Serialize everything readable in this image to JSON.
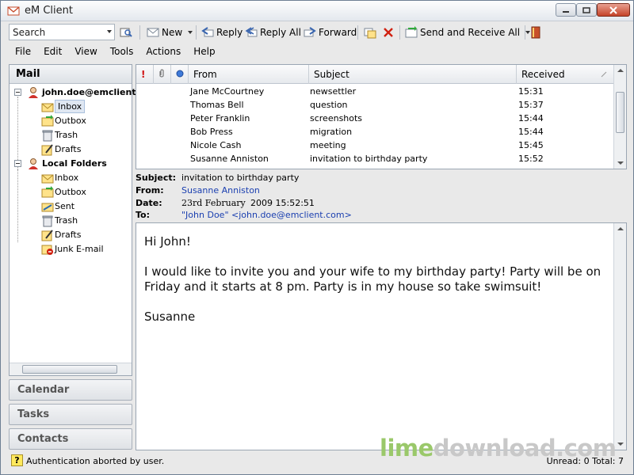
{
  "window": {
    "title": "eM Client"
  },
  "toolbar": {
    "search_placeholder": "Search",
    "new_label": "New",
    "reply_label": "Reply",
    "reply_all_label": "Reply All",
    "forward_label": "Forward",
    "send_receive_label": "Send and Receive All"
  },
  "menu": [
    "File",
    "Edit",
    "View",
    "Tools",
    "Actions",
    "Help"
  ],
  "sidebar": {
    "header": "Mail",
    "account": "john.doe@emclient.",
    "account_folders": [
      "Inbox",
      "Outbox",
      "Trash",
      "Drafts"
    ],
    "local": "Local Folders",
    "local_folders": [
      "Inbox",
      "Outbox",
      "Sent",
      "Trash",
      "Drafts",
      "Junk E-mail"
    ],
    "nav": [
      "Calendar",
      "Tasks",
      "Contacts"
    ]
  },
  "list": {
    "columns": {
      "from": "From",
      "subject": "Subject",
      "received": "Received"
    },
    "rows": [
      {
        "from": "Jane McCourtney",
        "subject": "newsettler",
        "received": "15:31"
      },
      {
        "from": "Thomas Bell",
        "subject": "question",
        "received": "15:37"
      },
      {
        "from": "Peter Franklin",
        "subject": "screenshots",
        "received": "15:44"
      },
      {
        "from": "Bob Press",
        "subject": "migration",
        "received": "15:44"
      },
      {
        "from": "Nicole Cash",
        "subject": "meeting",
        "received": "15:45"
      },
      {
        "from": "Susanne Anniston",
        "subject": "invitation to birthday party",
        "received": "15:52"
      }
    ]
  },
  "message": {
    "subject_key": "Subject:",
    "subject": "invitation to birthday party",
    "from_key": "From:",
    "from": "Susanne Anniston",
    "date_key": "Date:",
    "date_day": "23rd February",
    "date_rest": "2009 15:52:51",
    "to_key": "To:",
    "to": "\"John Doe\" <john.doe@emclient.com>",
    "body": [
      "Hi John!",
      "I would like to invite you and your wife to my birthday party! Party will be on Friday and it starts at 8 pm. Party is in my house so take swimsuit!",
      "Susanne"
    ]
  },
  "status": {
    "icon": "?",
    "text": "Authentication aborted by user.",
    "counts": "Unread: 0   Total: 7"
  },
  "watermark": {
    "part1": "lime",
    "part2": "download.com"
  },
  "colors": {
    "link": "#1a3fb0",
    "accent": "#dfe7f2"
  }
}
